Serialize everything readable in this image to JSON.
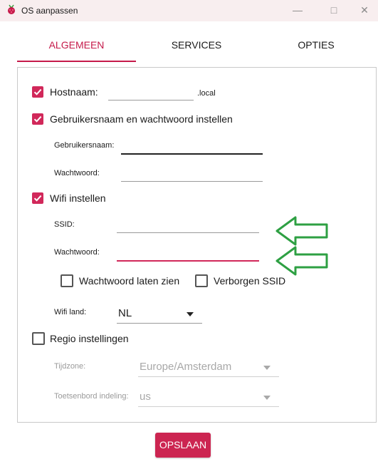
{
  "window": {
    "title": "OS aanpassen",
    "icon": "raspberry-pi-icon"
  },
  "tabs": [
    {
      "label": "ALGEMEEN",
      "active": true
    },
    {
      "label": "SERVICES",
      "active": false
    },
    {
      "label": "OPTIES",
      "active": false
    }
  ],
  "hostname": {
    "label": "Hostnaam:",
    "value": "",
    "suffix": ".local",
    "checked": true
  },
  "credentials": {
    "label": "Gebruikersnaam en wachtwoord instellen",
    "checked": true,
    "username_label": "Gebruikersnaam:",
    "username_value": "",
    "password_label": "Wachtwoord:",
    "password_value": ""
  },
  "wifi": {
    "label": "Wifi instellen",
    "checked": true,
    "ssid_label": "SSID:",
    "ssid_value": "",
    "password_label": "Wachtwoord:",
    "password_value": "",
    "show_password_label": "Wachtwoord laten zien",
    "hidden_ssid_label": "Verborgen SSID",
    "country_label": "Wifi land:",
    "country_value": "NL"
  },
  "region": {
    "label": "Regio instellingen",
    "checked": false,
    "timezone_label": "Tijdzone:",
    "timezone_value": "Europe/Amsterdam",
    "keyboard_label": "Toetsenbord indeling:",
    "keyboard_value": "us"
  },
  "save_button": "OPSLAAN",
  "colors": {
    "accent": "#c51a4a",
    "annotation": "#2ea043"
  }
}
